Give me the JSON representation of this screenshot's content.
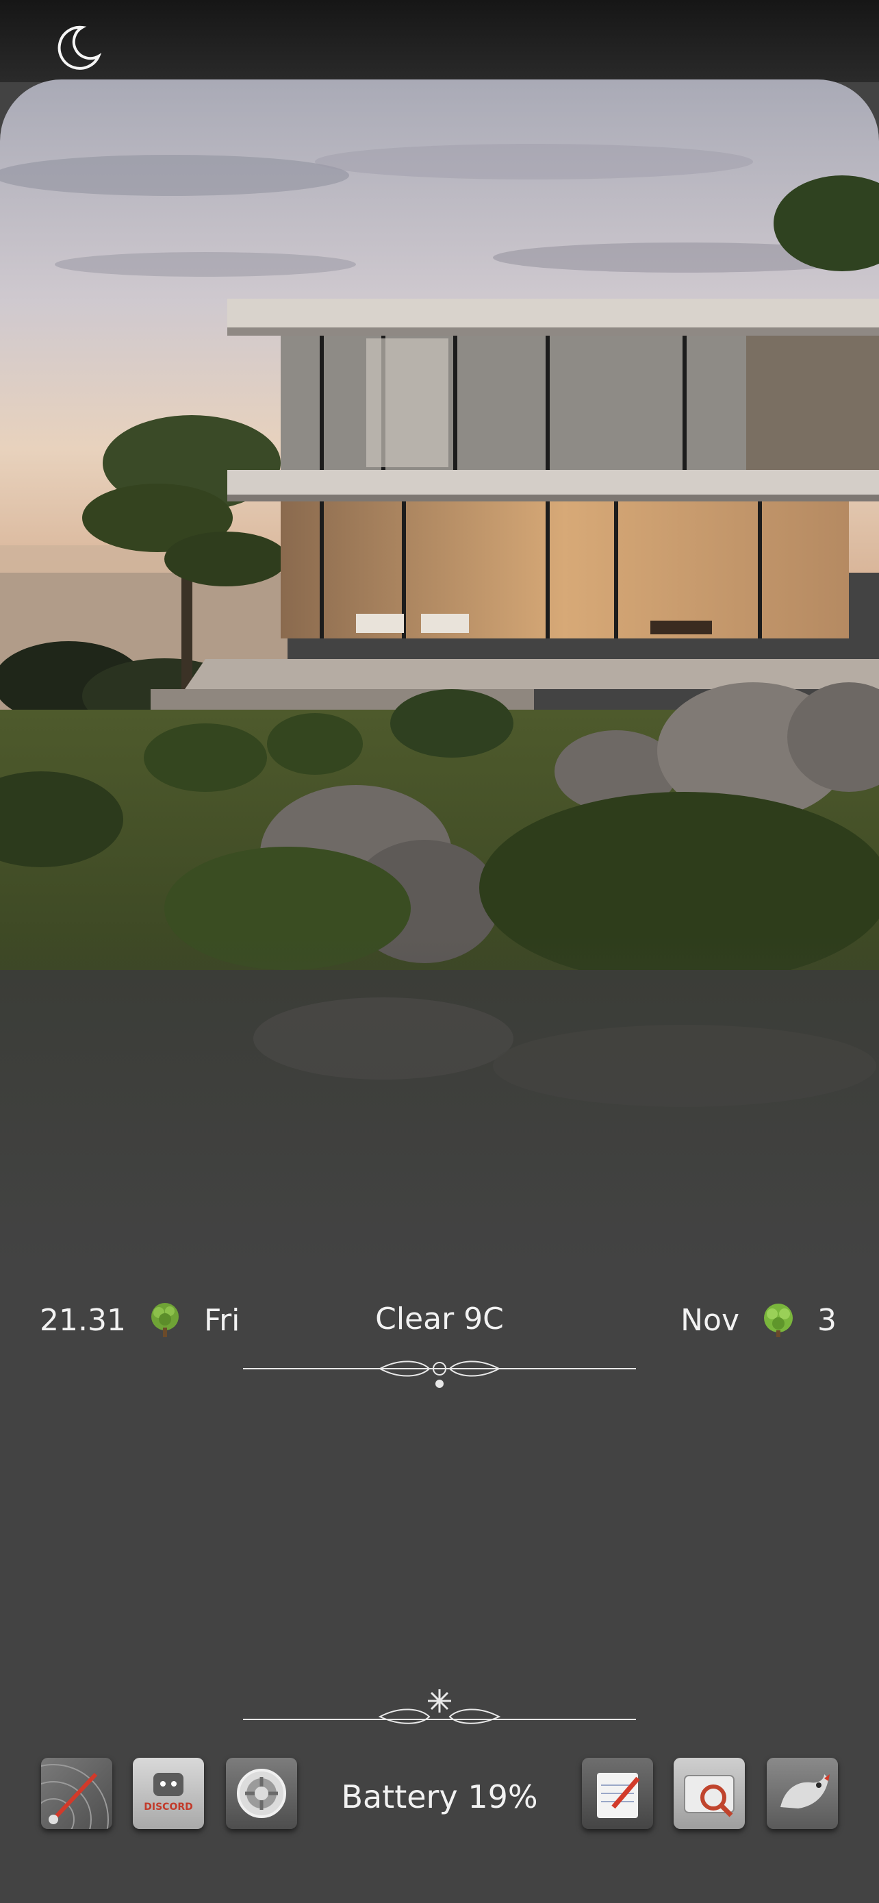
{
  "status": {
    "moon_icon": "crescent-moon-icon"
  },
  "widgets": {
    "time": "21.31",
    "day": "Fri",
    "weather": "Clear  9C",
    "month": "Nov",
    "date": "3",
    "battery": "Battery  19%"
  },
  "dock": {
    "apps": [
      {
        "name": "speedometer-app-icon"
      },
      {
        "name": "discord-app-icon",
        "label": "DISCORD"
      },
      {
        "name": "settings-gear-app-icon"
      },
      {
        "name": "notes-app-icon"
      },
      {
        "name": "file-search-app-icon"
      },
      {
        "name": "bird-app-icon"
      }
    ]
  },
  "colors": {
    "background": "#434343",
    "topbar": "#1c1c1c",
    "text": "#f2f2f2"
  }
}
